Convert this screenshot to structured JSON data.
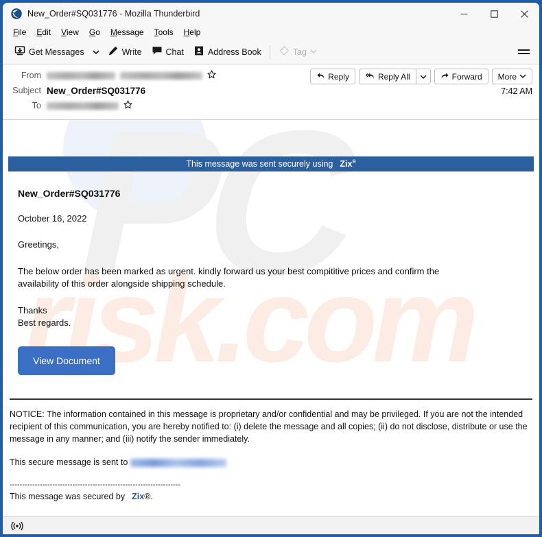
{
  "window": {
    "title": "New_Order#SQ031776 - Mozilla Thunderbird",
    "app_icon": "thunderbird-icon",
    "controls": {
      "minimize": "minimize-icon",
      "maximize": "maximize-icon",
      "close": "close-icon"
    }
  },
  "menubar": {
    "items": [
      {
        "label": "File",
        "accel": "F"
      },
      {
        "label": "Edit",
        "accel": "E"
      },
      {
        "label": "View",
        "accel": "V"
      },
      {
        "label": "Go",
        "accel": "G"
      },
      {
        "label": "Message",
        "accel": "M"
      },
      {
        "label": "Tools",
        "accel": "T"
      },
      {
        "label": "Help",
        "accel": "H"
      }
    ]
  },
  "toolbar": {
    "get_messages": "Get Messages",
    "write": "Write",
    "chat": "Chat",
    "address_book": "Address Book",
    "tag": "Tag",
    "tag_disabled": true,
    "menu_button": "app-menu-icon"
  },
  "message_header": {
    "from_label": "From",
    "from_value": "",
    "from_redacted": true,
    "subject_label": "Subject",
    "subject_value": "New_Order#SQ031776",
    "to_label": "To",
    "to_value": "",
    "to_redacted": true,
    "time": "7:42 AM",
    "actions": {
      "reply": "Reply",
      "reply_all": "Reply All",
      "forward": "Forward",
      "more": "More"
    }
  },
  "banner": {
    "text": "This message was sent securely using",
    "brand": "Zix",
    "trademark": "®",
    "background_color": "#2c5f9e",
    "text_color": "#ffffff"
  },
  "email": {
    "subject": "New_Order#SQ031776",
    "date": "October 16, 2022",
    "greeting": "Greetings,",
    "paragraph_line1": "The below order has been marked as urgent. kindly forward us your best compititive prices and confirm the",
    "paragraph_line2": "availability of this order alongside shipping schedule.",
    "signoff_line1": "Thanks",
    "signoff_line2": "Best regards.",
    "cta_label": "View Document",
    "cta_color": "#3a6fc4",
    "notice": "NOTICE: The information contained in this message is proprietary and/or confidential and may be privileged. If you are not the intended recipient of this communication, you are hereby notified to: (i) delete the message and all copies; (ii) do not disclose, distribute or use the message in any manner; and (iii) notify the sender immediately.",
    "secure_to_prefix": "This secure message is sent to",
    "secure_to_value": "",
    "secure_to_redacted": true,
    "dashed_divider": "--------------------------------------------------------------------",
    "secured_by_prefix": "This message was secured by",
    "secured_by_brand": "Zix",
    "secured_by_suffix": "®."
  },
  "watermark": {
    "primary": "PC",
    "secondary": "risk.com"
  },
  "statusbar": {
    "icon": "broadcast-icon"
  }
}
